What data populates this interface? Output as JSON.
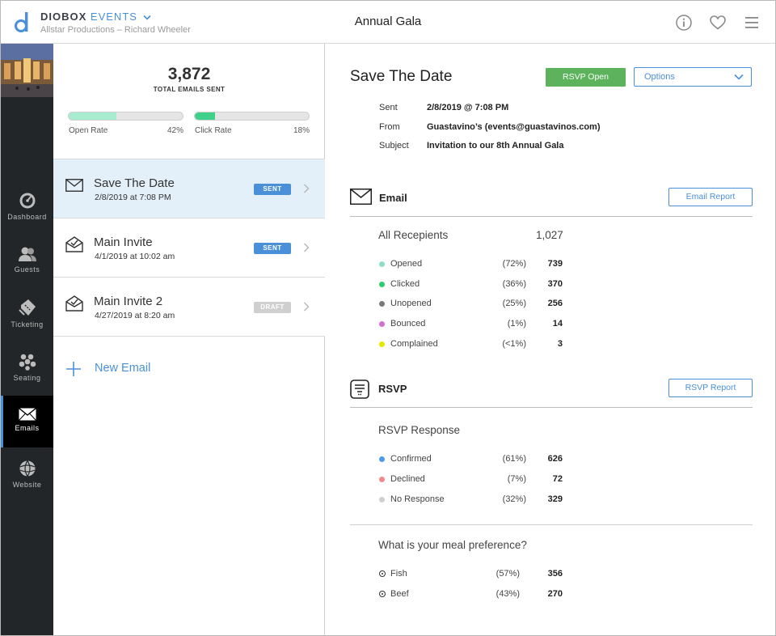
{
  "header": {
    "brand_main": "DIOBOX",
    "brand_accent": "EVENTS",
    "org": "Allstar Productions – Richard Wheeler",
    "event_title": "Annual Gala",
    "icons": [
      "info-icon",
      "heart-icon",
      "menu-icon"
    ]
  },
  "nav": {
    "items": [
      {
        "label": "Dashboard",
        "icon": "dashboard-icon"
      },
      {
        "label": "Guests",
        "icon": "guests-icon"
      },
      {
        "label": "Ticketing",
        "icon": "ticketing-icon"
      },
      {
        "label": "Seating",
        "icon": "seating-icon"
      },
      {
        "label": "Emails",
        "icon": "envelope-icon",
        "active": true
      },
      {
        "label": "Website",
        "icon": "globe-icon"
      }
    ]
  },
  "stats": {
    "total": "3,872",
    "total_label": "TOTAL EMAILS SENT",
    "open_label": "Open Rate",
    "open_value": "42%",
    "open_fraction": 0.42,
    "click_label": "Click Rate",
    "click_value": "18%",
    "click_fraction": 0.18
  },
  "emails": [
    {
      "name": "Save The Date",
      "date": "2/8/2019 at 7:08 PM",
      "status": "SENT",
      "icon": "envelope-icon"
    },
    {
      "name": "Main Invite",
      "date": "4/1/2019 at 10:02 am",
      "status": "SENT",
      "icon": "envelope-open-check-icon"
    },
    {
      "name": "Main Invite 2",
      "date": "4/27/2019 at 8:20 am",
      "status": "DRAFT",
      "icon": "envelope-open-check-icon"
    }
  ],
  "new_email": "New Email",
  "detail": {
    "title": "Save The Date",
    "rsvp_button": "RSVP Open",
    "options_label": "Options",
    "meta": [
      {
        "key": "Sent",
        "value": "2/8/2019 @ 7:08 PM"
      },
      {
        "key": "From",
        "value": "Guastavino’s (events@guastavinos.com)"
      },
      {
        "key": "Subject",
        "value": "Invitation to our 8th Annual Gala"
      }
    ],
    "email_section": {
      "title": "Email",
      "report_button": "Email Report",
      "sub_title": "All Recepients",
      "sub_total": "1,027",
      "rows": [
        {
          "label": "Opened",
          "pct": "(72%)",
          "value": "739",
          "color": "#8fe0c2"
        },
        {
          "label": "Clicked",
          "pct": "(36%)",
          "value": "370",
          "color": "#2ecc71"
        },
        {
          "label": "Unopened",
          "pct": "(25%)",
          "value": "256",
          "color": "#7a7a7a"
        },
        {
          "label": "Bounced",
          "pct": "(1%)",
          "value": "14",
          "color": "#d36fd0"
        },
        {
          "label": "Complained",
          "pct": "(<1%)",
          "value": "3",
          "color": "#e6e600"
        }
      ]
    },
    "rsvp_section": {
      "title": "RSVP",
      "report_button": "RSVP Report",
      "sub_title": "RSVP Response",
      "rows": [
        {
          "label": "Confirmed",
          "pct": "(61%)",
          "value": "626",
          "color": "#4a9be8"
        },
        {
          "label": "Declined",
          "pct": "(7%)",
          "value": "72",
          "color": "#f08a8a"
        },
        {
          "label": "No Response",
          "pct": "(32%)",
          "value": "329",
          "color": "#cfcfcf"
        }
      ],
      "meal_title": "What is your meal preference?",
      "meal_rows": [
        {
          "label": "Fish",
          "pct": "(57%)",
          "value": "356"
        },
        {
          "label": "Beef",
          "pct": "(43%)",
          "value": "270"
        }
      ]
    }
  },
  "colors": {
    "accent": "#4a90d9",
    "sent_badge": "#4a90d9",
    "draft_badge": "#cfcfcf",
    "rsvp_open": "#5cb35b",
    "open_bar": "#a8ecd0",
    "click_bar": "#3fd08a",
    "selected_row": "#e3f0fa",
    "nav_bg": "#232628"
  }
}
